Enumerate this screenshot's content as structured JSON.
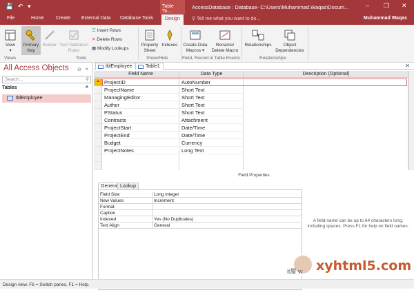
{
  "titlebar": {
    "save_icon": "save-icon",
    "undo_icon": "undo-icon",
    "qa_more": "▾",
    "context_label": "Table To...",
    "title": "AccessDatabase : Database- C:\\Users\\Muhammad.Waqas\\Docum...",
    "min": "–",
    "restore": "❐",
    "close": "✕",
    "user": "Muhammad Waqas"
  },
  "tabs": [
    {
      "label": "File"
    },
    {
      "label": "Home"
    },
    {
      "label": "Create"
    },
    {
      "label": "External Data"
    },
    {
      "label": "Database Tools"
    },
    {
      "label": "Design"
    }
  ],
  "tell": "Tell me what you want to do...",
  "ribbon": {
    "view": "View",
    "primary_key": "Primary\nKey",
    "builder": "Builder",
    "test_validation": "Test Validation\nRules",
    "insert_rows": "Insert Rows",
    "delete_rows": "Delete Rows",
    "modify_lookups": "Modify Lookups",
    "property_sheet": "Property\nSheet",
    "indexes": "Indexes",
    "create_data_macros": "Create Data\nMacros ▾",
    "rename_delete_macro": "Rename/\nDelete Macro",
    "relationships": "Relationships",
    "object_dependencies": "Object\nDependencies",
    "groups": {
      "views": "Views",
      "tools": "Tools",
      "show_hide": "Show/Hide",
      "field_record": "Field, Record & Table Events",
      "relationships": "Relationships"
    }
  },
  "nav": {
    "title": "All Access Objects",
    "chevron": "⊙",
    "close": "«",
    "search_placeholder": "Search...",
    "category": "Tables",
    "item": "tblEmployee"
  },
  "doc": {
    "tabs": [
      {
        "label": "tblEmployee"
      },
      {
        "label": "Table1"
      }
    ],
    "close": "✕",
    "headers": {
      "field": "Field Name",
      "type": "Data Type",
      "desc": "Description (Optional)"
    },
    "rows": [
      {
        "name": "ProjectID",
        "type": "AutoNumber"
      },
      {
        "name": "ProjectName",
        "type": "Short Text"
      },
      {
        "name": "ManagingEditor",
        "type": "Short Text"
      },
      {
        "name": "Author",
        "type": "Short Text"
      },
      {
        "name": "PStatus",
        "type": "Short Text"
      },
      {
        "name": "Contracts",
        "type": "Attachment"
      },
      {
        "name": "ProjectStart",
        "type": "Date/Time"
      },
      {
        "name": "ProjectEnd",
        "type": "Date/Time"
      },
      {
        "name": "Budget",
        "type": "Currency"
      },
      {
        "name": "ProjectNotes",
        "type": "Long Text"
      }
    ]
  },
  "field_properties": {
    "title": "Field Properties",
    "tabs": [
      {
        "label": "General"
      },
      {
        "label": "Lookup"
      }
    ],
    "props": [
      {
        "label": "Field Size",
        "value": "Long Integer"
      },
      {
        "label": "New Values",
        "value": "Increment"
      },
      {
        "label": "Format",
        "value": ""
      },
      {
        "label": "Caption",
        "value": ""
      },
      {
        "label": "Indexed",
        "value": "Yes (No Duplicates)"
      },
      {
        "label": "Text Align",
        "value": "General"
      }
    ],
    "help": "A field name can be up to 64 characters long, including spaces. Press F1 for help on field names."
  },
  "status": "Design view.  F6 = Switch panes.  F1 = Help.",
  "watermark": {
    "text": "xyhtml5.com",
    "sub": "it屋 w"
  }
}
